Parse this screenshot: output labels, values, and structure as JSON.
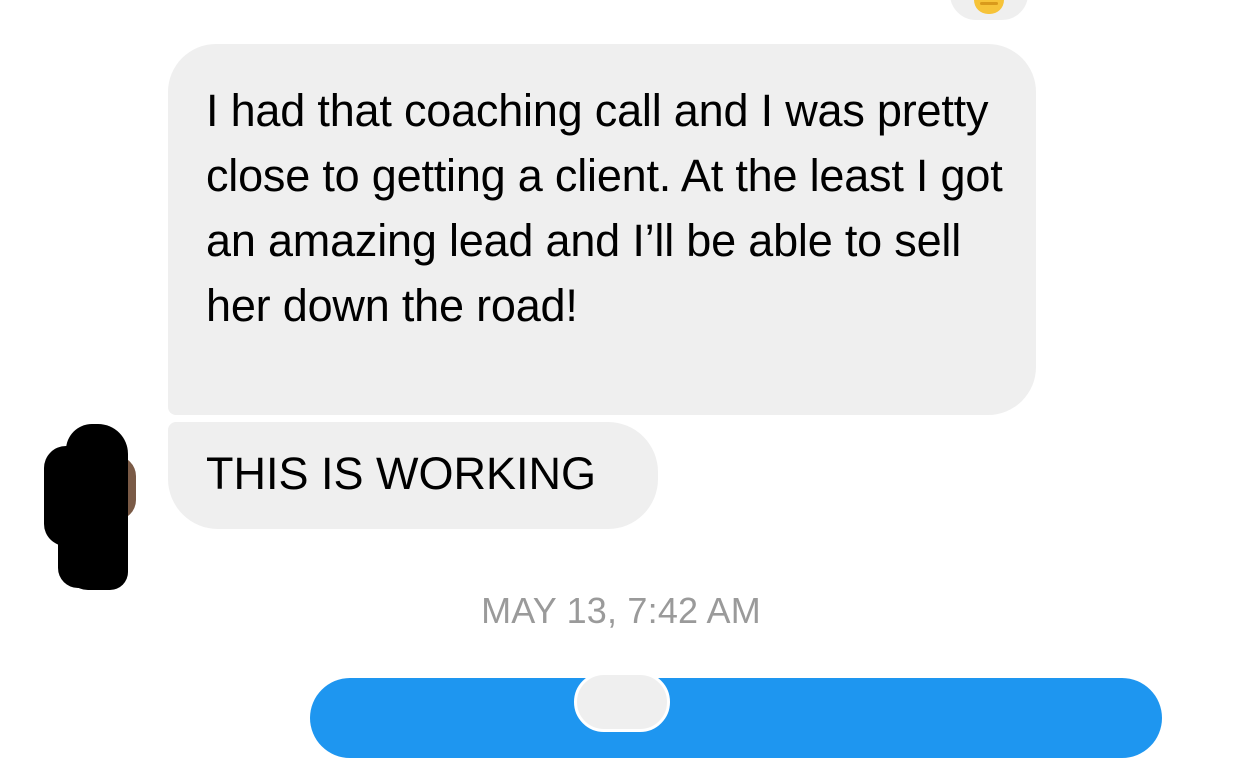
{
  "conversation": {
    "messages": [
      {
        "sender": "contact",
        "text": "I had that coaching call and I was pretty close to getting a client. At the least I got an amazing lead and I’ll be able to sell her down the road!"
      },
      {
        "sender": "contact",
        "text": "THIS IS WORKING"
      }
    ],
    "reaction_icon": "hand-emoji-icon",
    "timestamp": "MAY 13, 7:42 AM"
  },
  "colors": {
    "incoming_bubble": "#efefef",
    "outgoing_bubble": "#1e96f0",
    "timestamp_text": "#9a9a9a",
    "redaction": "#000000"
  }
}
